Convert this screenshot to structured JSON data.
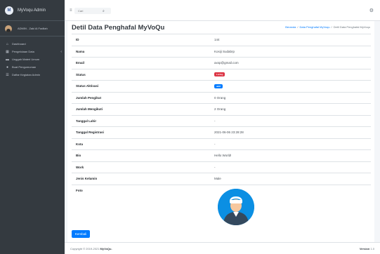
{
  "app": {
    "brand": "MyVoqu Admin",
    "brand_logo_letter": "M"
  },
  "user": {
    "name": "ADMIN - Zaki Al Fadilah"
  },
  "sidebar": {
    "items": [
      {
        "label": "Dashboard",
        "icon": "home-icon",
        "glyph": "⌂"
      },
      {
        "label": "Pengelolaan Data",
        "icon": "table-icon",
        "glyph": "▦",
        "caret": "‹"
      },
      {
        "label": "Unggah Materi Umum",
        "icon": "book-icon",
        "glyph": "▬"
      },
      {
        "label": "Buat Pengumuman",
        "icon": "info-circle-icon",
        "glyph": "●"
      },
      {
        "label": "Daftar Kegiatan Admin",
        "icon": "list-icon",
        "glyph": "☰"
      }
    ]
  },
  "topbar": {
    "menu_glyph": "≡",
    "search_placeholder": "Cari",
    "search_glyph": "⌕",
    "settings_glyph": "⚙"
  },
  "page": {
    "title": "Detil Data Penghafal MyVoQu",
    "breadcrumb": [
      "Beranda",
      "/",
      "Data Penghafal MyVoqu",
      "/",
      "Detil Data Penghafal MyVoqu"
    ]
  },
  "details": [
    {
      "label": "ID",
      "value": "144"
    },
    {
      "label": "Nama",
      "value": "Kosiji Sudabrp"
    },
    {
      "label": "Email",
      "value": "axsp@gmail.com"
    },
    {
      "label": "Status",
      "badge": "Luring",
      "badge_color": "#dc3545"
    },
    {
      "label": "Status Aktivasi",
      "badge": "aktif",
      "badge_color": "#007bff"
    },
    {
      "label": "Jumlah Pengikut",
      "value": "0 Orang"
    },
    {
      "label": "Jumlah Mengikuti",
      "value": "2 Orang"
    },
    {
      "label": "Tanggal Lahir",
      "value": "-"
    },
    {
      "label": "Tanggal Registrasi",
      "value": "2021-06-06 23:28:28"
    },
    {
      "label": "Kota",
      "value": "-"
    },
    {
      "label": "Bio",
      "value": "Hello World!"
    },
    {
      "label": "Work",
      "value": "-"
    },
    {
      "label": "Jenis Kelamin",
      "value": "Male"
    },
    {
      "label": "Foto"
    }
  ],
  "actions": {
    "back_label": "Kembali"
  },
  "footer": {
    "copyright_prefix": "Copyright © 2019-2021",
    "copyright_brand": "MyVoQu.",
    "version_label": "Version",
    "version_value": "1.0"
  },
  "colors": {
    "sidebar_bg": "#343a40",
    "primary": "#007bff",
    "danger": "#dc3545",
    "avatar_bg": "#0b8fe3"
  }
}
